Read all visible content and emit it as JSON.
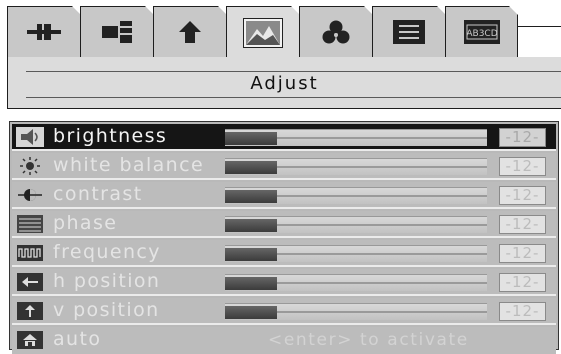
{
  "tabs": [
    {
      "icon": "position-icon",
      "active": false
    },
    {
      "icon": "layout-icon",
      "active": false
    },
    {
      "icon": "up-arrow-icon",
      "active": false
    },
    {
      "icon": "picture-icon",
      "active": true
    },
    {
      "icon": "color-icon",
      "active": false
    },
    {
      "icon": "menu-list-icon",
      "active": false
    },
    {
      "icon": "language-icon",
      "active": false
    }
  ],
  "panel": {
    "title": "Adjust"
  },
  "menu": {
    "items": [
      {
        "label": "brightness",
        "icon": "brightness-icon",
        "value": "-12-",
        "level": 0.2,
        "selected": true
      },
      {
        "label": "white balance",
        "icon": "white-balance-icon",
        "value": "-12-",
        "level": 0.2,
        "selected": false
      },
      {
        "label": "contrast",
        "icon": "contrast-icon",
        "value": "-12-",
        "level": 0.2,
        "selected": false
      },
      {
        "label": "phase",
        "icon": "phase-icon",
        "value": "-12-",
        "level": 0.2,
        "selected": false
      },
      {
        "label": "frequency",
        "icon": "frequency-icon",
        "value": "-12-",
        "level": 0.2,
        "selected": false
      },
      {
        "label": "h position",
        "icon": "h-position-icon",
        "value": "-12-",
        "level": 0.2,
        "selected": false
      },
      {
        "label": "v position",
        "icon": "v-position-icon",
        "value": "-12-",
        "level": 0.2,
        "selected": false
      },
      {
        "label": "auto",
        "icon": "auto-icon",
        "action": "<enter> to activate",
        "selected": false
      }
    ]
  }
}
